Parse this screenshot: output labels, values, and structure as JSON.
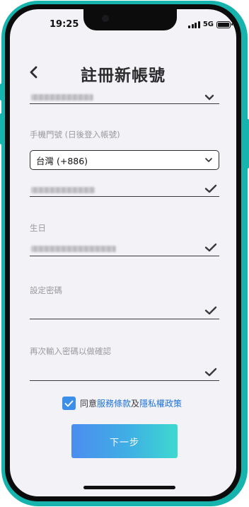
{
  "status_bar": {
    "time": "19:25",
    "network": "5G"
  },
  "header": {
    "title": "註冊新帳號"
  },
  "form": {
    "phone_label": "手機門號 (日後登入帳號)",
    "country_code": "台灣 (+886)",
    "birthday_label": "生日",
    "password_label": "設定密碼",
    "password_confirm_label": "再次輸入密碼以做確認"
  },
  "agreement": {
    "prefix": "同意",
    "terms_link": "服務條款",
    "conjunction": "及",
    "privacy_link": "隱私權政策",
    "checked": true
  },
  "actions": {
    "next_label": "下一步"
  },
  "colors": {
    "frame": "#17b3ad",
    "accent": "#3b8fe8",
    "link": "#1e72d8",
    "button_gradient_start": "#4c8df0",
    "button_gradient_end": "#3ed9cf"
  }
}
